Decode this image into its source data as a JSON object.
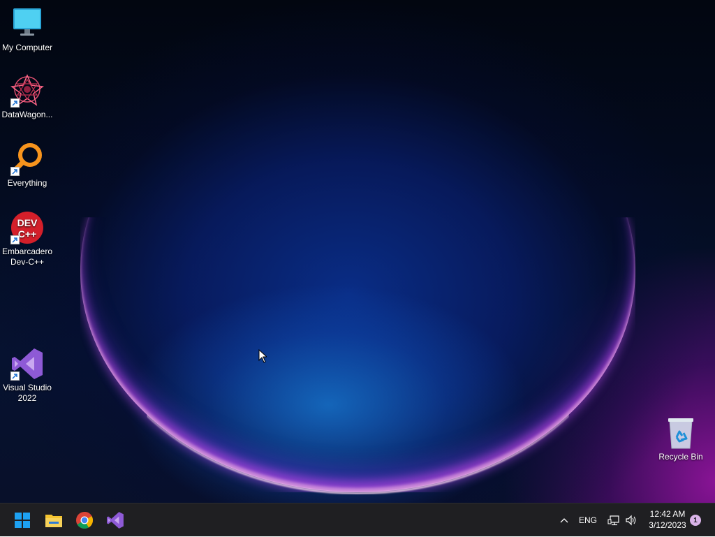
{
  "desktop": {
    "icons": [
      {
        "label": "My Computer",
        "icon": "monitor-icon"
      },
      {
        "label": "DataWagon...",
        "icon": "datawagon-icon"
      },
      {
        "label": "Everything",
        "icon": "everything-search-icon"
      },
      {
        "label": "Embarcadero Dev-C++",
        "icon": "devcpp-icon",
        "badge_text": "DEV C++"
      },
      {
        "label": "Visual Studio 2022",
        "icon": "visual-studio-icon"
      },
      {
        "label": "Recycle Bin",
        "icon": "recycle-bin-icon"
      }
    ]
  },
  "taskbar": {
    "pinned": [
      {
        "name": "Start",
        "icon": "windows-start-icon"
      },
      {
        "name": "File Explorer",
        "icon": "folder-icon"
      },
      {
        "name": "Google Chrome",
        "icon": "chrome-icon"
      },
      {
        "name": "Visual Studio",
        "icon": "visual-studio-icon"
      }
    ],
    "tray": {
      "overflow": "^",
      "language": "ENG",
      "network_icon": "network-icon",
      "volume_icon": "volume-icon",
      "time": "12:42 AM",
      "date": "3/12/2023",
      "notification_count": "1"
    }
  },
  "colors": {
    "taskbar_bg": "#1f1f22",
    "start_blue": "#1da1f2",
    "folder_yellow": "#f4c430",
    "vs_purple": "#8e5ad6"
  }
}
